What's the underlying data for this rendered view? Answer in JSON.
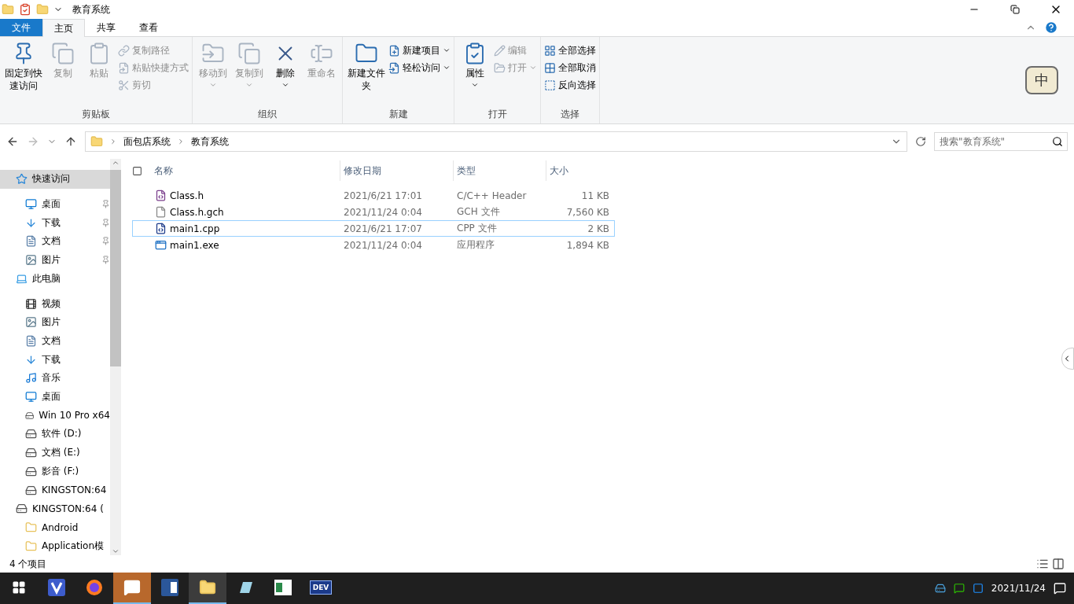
{
  "window": {
    "title": "教育系统"
  },
  "ribbon_tabs": [
    {
      "label": "文件",
      "kind": "file",
      "selected": false
    },
    {
      "label": "主页",
      "kind": "tab",
      "selected": true
    },
    {
      "label": "共享",
      "kind": "tab",
      "selected": false
    },
    {
      "label": "查看",
      "kind": "tab",
      "selected": false
    }
  ],
  "ribbon": {
    "groups": [
      {
        "label": "剪贴板",
        "items": [
          {
            "kind": "large",
            "label": "固定到快速访问",
            "disabled": false,
            "dropdown": false
          },
          {
            "kind": "large",
            "label": "复制",
            "disabled": true,
            "dropdown": false
          },
          {
            "kind": "large",
            "label": "粘贴",
            "disabled": true,
            "dropdown": false
          },
          {
            "kind": "small",
            "label": "复制路径",
            "disabled": true,
            "dropdown": false
          },
          {
            "kind": "small",
            "label": "粘贴快捷方式",
            "disabled": true,
            "dropdown": false
          },
          {
            "kind": "small",
            "label": "剪切",
            "disabled": true,
            "dropdown": false
          }
        ]
      },
      {
        "label": "组织",
        "items": [
          {
            "kind": "large",
            "label": "移动到",
            "disabled": true,
            "dropdown": true
          },
          {
            "kind": "large",
            "label": "复制到",
            "disabled": true,
            "dropdown": true
          },
          {
            "kind": "large",
            "label": "删除",
            "disabled": false,
            "dropdown": true
          },
          {
            "kind": "large",
            "label": "重命名",
            "disabled": true,
            "dropdown": false
          }
        ]
      },
      {
        "label": "新建",
        "items": [
          {
            "kind": "large",
            "label": "新建文件夹",
            "disabled": false,
            "dropdown": false
          },
          {
            "kind": "small",
            "label": "新建项目",
            "disabled": false,
            "dropdown": true
          },
          {
            "kind": "small",
            "label": "轻松访问",
            "disabled": false,
            "dropdown": true
          }
        ]
      },
      {
        "label": "打开",
        "items": [
          {
            "kind": "large",
            "label": "属性",
            "disabled": false,
            "dropdown": true
          },
          {
            "kind": "small",
            "label": "编辑",
            "disabled": true,
            "dropdown": false
          },
          {
            "kind": "small",
            "label": "打开",
            "disabled": true,
            "dropdown": true
          }
        ]
      },
      {
        "label": "选择",
        "items": [
          {
            "kind": "small",
            "label": "全部选择",
            "disabled": false,
            "dropdown": false
          },
          {
            "kind": "small",
            "label": "全部取消",
            "disabled": false,
            "dropdown": false
          },
          {
            "kind": "small",
            "label": "反向选择",
            "disabled": false,
            "dropdown": false
          }
        ]
      }
    ],
    "ime_badge": "中"
  },
  "address_bar": {
    "path": [
      "面包店系统",
      "教育系统"
    ]
  },
  "search": {
    "placeholder": "搜索\"教育系统\""
  },
  "sidebar": {
    "items": [
      {
        "label": "快速访问",
        "kind": "star",
        "selected": true,
        "pinned": false,
        "children": [
          {
            "label": "桌面",
            "kind": "desktop",
            "selected": false,
            "pinned": true
          },
          {
            "label": "下载",
            "kind": "download",
            "selected": false,
            "pinned": true
          },
          {
            "label": "文档",
            "kind": "document",
            "selected": false,
            "pinned": true
          },
          {
            "label": "图片",
            "kind": "picture",
            "selected": false,
            "pinned": true
          }
        ]
      },
      {
        "label": "此电脑",
        "kind": "pc",
        "selected": false,
        "pinned": false,
        "children": [
          {
            "label": "视频",
            "kind": "video",
            "selected": false,
            "pinned": false
          },
          {
            "label": "图片",
            "kind": "picture",
            "selected": false,
            "pinned": false
          },
          {
            "label": "文档",
            "kind": "document",
            "selected": false,
            "pinned": false
          },
          {
            "label": "下载",
            "kind": "download",
            "selected": false,
            "pinned": false
          },
          {
            "label": "音乐",
            "kind": "music",
            "selected": false,
            "pinned": false
          },
          {
            "label": "桌面",
            "kind": "desktop",
            "selected": false,
            "pinned": false
          },
          {
            "label": "Win 10 Pro x64",
            "kind": "os-drive",
            "selected": false,
            "pinned": false
          },
          {
            "label": "软件 (D:)",
            "kind": "drive",
            "selected": false,
            "pinned": false
          },
          {
            "label": "文档 (E:)",
            "kind": "drive",
            "selected": false,
            "pinned": false
          },
          {
            "label": "影音 (F:)",
            "kind": "drive",
            "selected": false,
            "pinned": false
          },
          {
            "label": "KINGSTON:64",
            "kind": "drive",
            "selected": false,
            "pinned": false
          }
        ]
      },
      {
        "label": "KINGSTON:64 (",
        "kind": "drive",
        "selected": false,
        "pinned": false,
        "children": [
          {
            "label": "Android",
            "kind": "folder",
            "selected": false,
            "pinned": false
          },
          {
            "label": "Application模",
            "kind": "folder",
            "selected": false,
            "pinned": false
          }
        ]
      }
    ]
  },
  "table": {
    "select_all_checked": false,
    "columns": [
      "名称",
      "修改日期",
      "类型",
      "大小"
    ],
    "rows": [
      {
        "kind": "header",
        "focused": false,
        "cells": [
          "Class.h",
          "2021/6/21 17:01",
          "C/C++ Header",
          "11 KB"
        ]
      },
      {
        "kind": "blank",
        "focused": false,
        "cells": [
          "Class.h.gch",
          "2021/11/24 0:04",
          "GCH 文件",
          "7,560 KB"
        ]
      },
      {
        "kind": "cpp",
        "focused": true,
        "cells": [
          "main1.cpp",
          "2021/6/21 17:07",
          "CPP 文件",
          "2 KB"
        ]
      },
      {
        "kind": "exe",
        "focused": false,
        "cells": [
          "main1.exe",
          "2021/11/24 0:04",
          "应用程序",
          "1,894 KB"
        ]
      }
    ]
  },
  "status_bar": {
    "count": "4 个项目"
  },
  "taskbar": {
    "apps": [
      {
        "kind": "v",
        "active": false
      },
      {
        "kind": "firefox",
        "active": false
      },
      {
        "kind": "wechat",
        "active": true
      },
      {
        "kind": "word",
        "active": false
      },
      {
        "kind": "explorer",
        "active": true
      },
      {
        "kind": "notebook",
        "active": false
      },
      {
        "kind": "window",
        "active": false
      },
      {
        "kind": "dev",
        "active": false
      }
    ],
    "dev_label": "DEV",
    "date": "2021/11/24"
  }
}
